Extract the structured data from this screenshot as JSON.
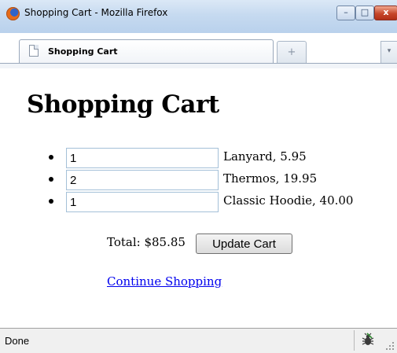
{
  "window": {
    "title": "Shopping Cart - Mozilla Firefox",
    "controls": {
      "minimize": "–",
      "maximize": "□",
      "close": "x"
    }
  },
  "tabs": {
    "active_label": "Shopping Cart",
    "new_tab_glyph": "+",
    "list_glyph": "▾"
  },
  "page": {
    "heading": "Shopping Cart",
    "items": [
      {
        "qty": "1",
        "label": "Lanyard, 5.95"
      },
      {
        "qty": "2",
        "label": "Thermos, 19.95"
      },
      {
        "qty": "1",
        "label": "Classic Hoodie, 40.00"
      }
    ],
    "total_label": "Total: $85.85",
    "update_button": "Update Cart",
    "continue_link": "Continue Shopping"
  },
  "statusbar": {
    "text": "Done"
  },
  "icons": {
    "browser": "firefox-icon",
    "page": "page-icon",
    "status": "bug-icon",
    "resize": "resize-grip-icon"
  },
  "colors": {
    "link": "#0000ee",
    "titlebar": "#c6daf0"
  }
}
